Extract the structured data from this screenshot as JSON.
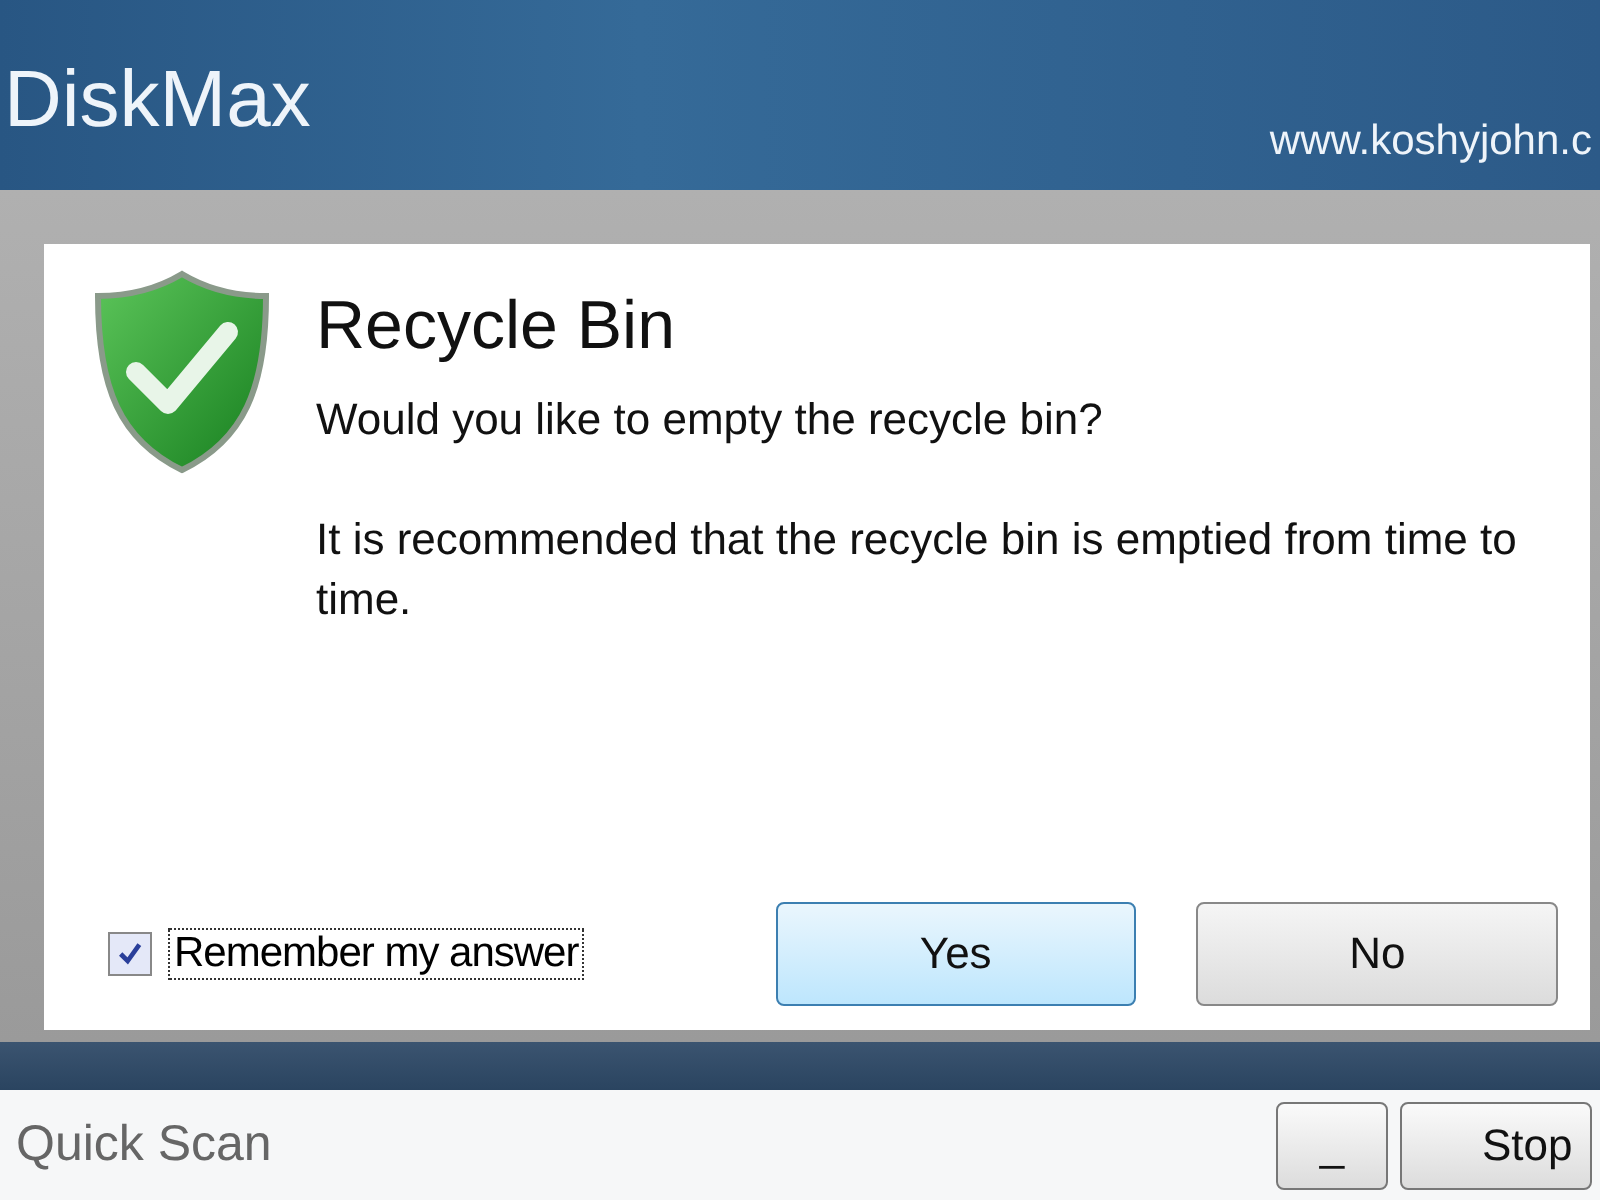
{
  "app": {
    "title": "DiskMax",
    "website": "www.koshyjohn.c"
  },
  "dialog": {
    "title": "Recycle Bin",
    "question": "Would you like to empty the recycle bin?",
    "note": "It is recommended that the recycle bin is emptied from time to time.",
    "remember": {
      "label": "Remember my answer",
      "checked": true
    },
    "buttons": [
      {
        "label": "Yes",
        "selected": true
      },
      {
        "label": "No",
        "selected": false
      }
    ]
  },
  "status_bar": {
    "scan_label": "Quick Scan",
    "buttons": [
      "_",
      "Stop"
    ]
  }
}
